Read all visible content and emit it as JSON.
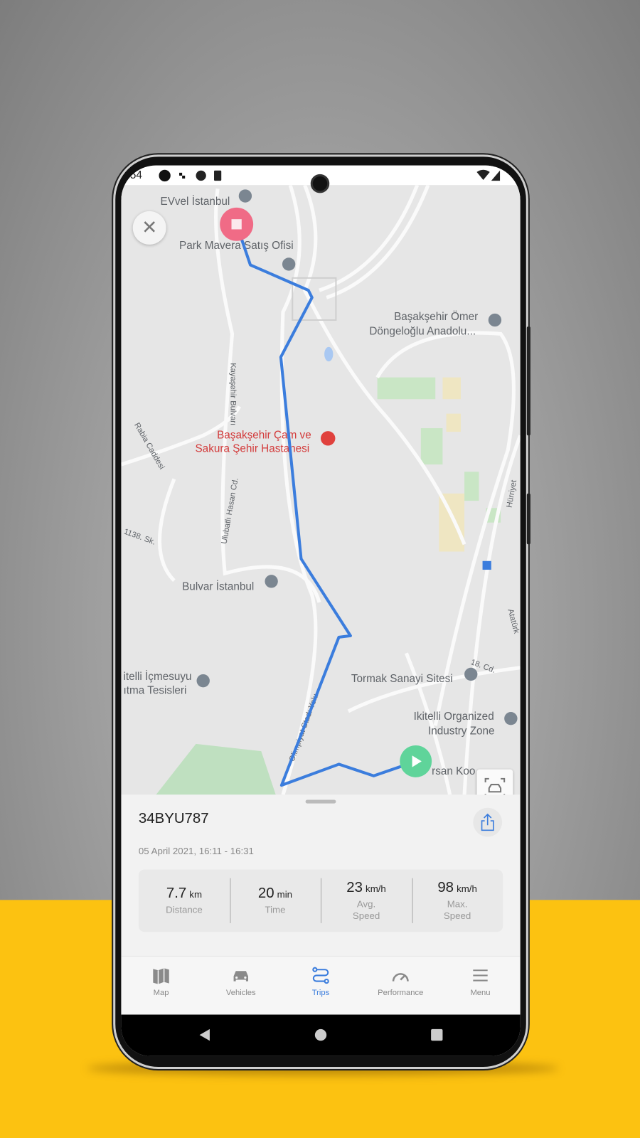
{
  "status_bar": {
    "time": ":54"
  },
  "map": {
    "labels": [
      "EVvel İstanbul",
      "Park Mavera Satış Ofisi",
      "Başakşehir Ömer",
      "Döngeloğlu Anadolu...",
      "Başakşehir Çam ve",
      "Sakura Şehir Hastanesi",
      "Bulvar İstanbul",
      "Tormak Sanayi Sitesi",
      "Ikitelli Organized",
      "Industry Zone",
      "itelli İçmesuyu",
      "ıtma Tesisleri",
      "rsan Koo",
      "Kayaşehir Bulvarı",
      "Ulubatlı Hasan Cd.",
      "Rabia Caddesi",
      "1138. Sk.",
      "Olimpiyat Stadı Yolu",
      "18. Cd.",
      "Hürriyet",
      "Atatürk"
    ],
    "route_color": "#3b7ddd",
    "start_color": "#5fd49a",
    "end_color": "#f06b86"
  },
  "trip": {
    "plate": "34BYU787",
    "date": "05 April 2021,  16:11 - 16:31",
    "stats": [
      {
        "value": "7.7",
        "unit": "km",
        "label": "Distance"
      },
      {
        "value": "20",
        "unit": "min",
        "label": "Time"
      },
      {
        "value": "23",
        "unit": "km/h",
        "label": "Avg. Speed"
      },
      {
        "value": "98",
        "unit": "km/h",
        "label": "Max. Speed"
      }
    ]
  },
  "nav": {
    "items": [
      {
        "label": "Map"
      },
      {
        "label": "Vehicles"
      },
      {
        "label": "Trips",
        "active": true
      },
      {
        "label": "Performance"
      },
      {
        "label": "Menu"
      }
    ]
  },
  "colors": {
    "accent": "#3b7ddd",
    "background_yellow": "#fcc211"
  }
}
